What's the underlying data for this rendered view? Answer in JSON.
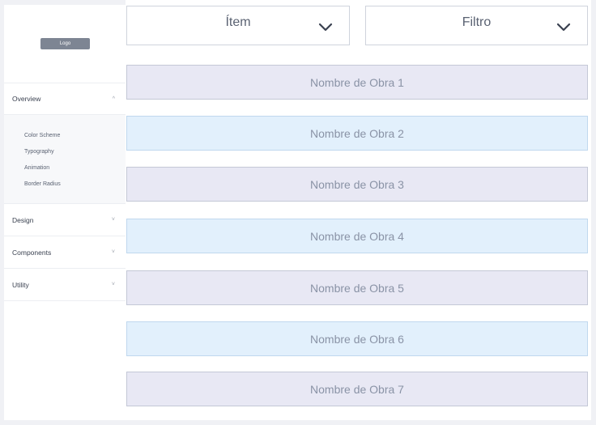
{
  "sidebar": {
    "logo": "Logo",
    "nav": [
      {
        "label": "Overview",
        "expanded": true,
        "chevron": "^",
        "icon": "chevron-up-icon"
      },
      {
        "label": "Design",
        "expanded": false,
        "chevron": "˅",
        "icon": "chevron-down-icon"
      },
      {
        "label": "Components",
        "expanded": false,
        "chevron": "˅",
        "icon": "chevron-down-icon"
      },
      {
        "label": "Utility",
        "expanded": false,
        "chevron": "˅",
        "icon": "chevron-down-icon"
      }
    ],
    "overview_sub": [
      "Color Scheme",
      "Typography",
      "Animation",
      "Border Radius"
    ]
  },
  "filters": {
    "item_label": "Ítem",
    "filter_label": "Filtro"
  },
  "obras": [
    "Nombre de Obra 1",
    "Nombre de Obra 2",
    "Nombre de Obra 3",
    "Nombre de Obra 4",
    "Nombre de Obra 5",
    "Nombre de Obra 6",
    "Nombre de Obra 7"
  ],
  "colors": {
    "row_alt_1": "#e8e8f4",
    "row_alt_2": "#e2f0fc",
    "logo_bg": "#7d8593"
  }
}
